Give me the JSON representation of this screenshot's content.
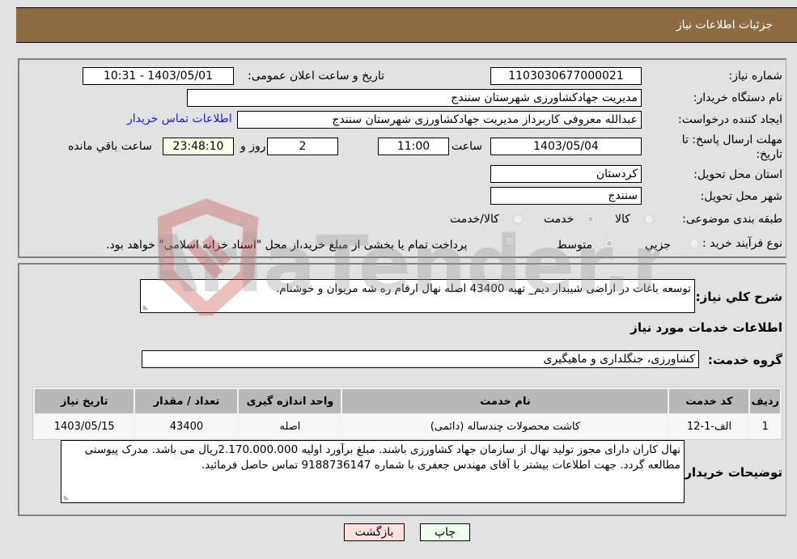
{
  "header": {
    "title": "جزئیات اطلاعات نیاز"
  },
  "form": {
    "need_number": {
      "label": "شماره نیاز:",
      "value": "1103030677000021"
    },
    "announce_datetime": {
      "label": "تاریخ و ساعت اعلان عمومی:",
      "value": "1403/05/01 - 10:31"
    },
    "buyer_org": {
      "label": "نام دستگاه خریدار:",
      "value": "مدیریت جهادکشاورزی شهرستان سنندج"
    },
    "requester": {
      "label": "ایجاد کننده درخواست:",
      "value": "عبدالله معروفی کاربرداز مدیریت جهادکشاورزی شهرستان سنندج"
    },
    "buyer_contact_link": "اطلاعات تماس خریدار",
    "deadline": {
      "label": "مهلت ارسال پاسخ: تا تاریخ:",
      "date": "1403/05/04",
      "time_label": "ساعت",
      "time": "11:00",
      "days": "2",
      "days_label": "روز و",
      "remaining": "23:48:10",
      "remaining_label": "ساعت باقي مانده"
    },
    "province": {
      "label": "استان محل تحویل:",
      "value": "کردستان"
    },
    "city": {
      "label": "شهر محل تحویل:",
      "value": "سنندج"
    },
    "category": {
      "label": "طبقه بندی موضوعی:",
      "options": [
        "کالا",
        "خدمت",
        "کالا/خدمت"
      ],
      "selected": "خدمت"
    },
    "purchase_type": {
      "label": "نوع فرآیند خرید :",
      "options": [
        "جزيي",
        "متوسط"
      ],
      "selected": "متوسط",
      "treasury_checkbox_label": "پرداخت تمام یا بخشی از مبلغ خرید،از محل \"اسناد خزانه اسلامی\" خواهد بود.",
      "treasury_checked": false
    }
  },
  "details": {
    "description": {
      "label": "شرح کلي نیاز:",
      "value": "توسعه باغات در اراضی شیبدار دیم_ تهیه 43400 اصله نهال ارقام ره شه مریوان و خوشنام."
    },
    "services_title": "اطلاعات خدمات مورد نیاز",
    "service_group": {
      "label": "گروه خدمت:",
      "value": "کشاورزی، جنگلداری و ماهیگیری"
    },
    "table": {
      "headers": [
        "ردیف",
        "کد خدمت",
        "نام خدمت",
        "واحد اندازه گیری",
        "تعداد / مقدار",
        "تاریخ نیاز"
      ],
      "rows": [
        [
          "1",
          "الف-1-12",
          "کاشت محصولات چندساله (دائمی)",
          "اصله",
          "43400",
          "1403/05/15"
        ]
      ]
    },
    "buyer_notes": {
      "label": "توضیحات خریدار:",
      "value": "نهال کاران دارای مجوز تولید نهال از سازمان جهاد کشاورزی باشند. مبلغ برآورد اولیه 2.170.000.000ریال می باشد. مدرک پیوستی مطالعه گردد. جهت اطلاعات بیشتر با آقای مهندس جعفری با شماره 9188736147 تماس حاصل فرمائید."
    }
  },
  "buttons": {
    "print": "چاپ",
    "back": "بازگشت"
  },
  "watermark": {
    "text": "AriaTender.neT"
  }
}
